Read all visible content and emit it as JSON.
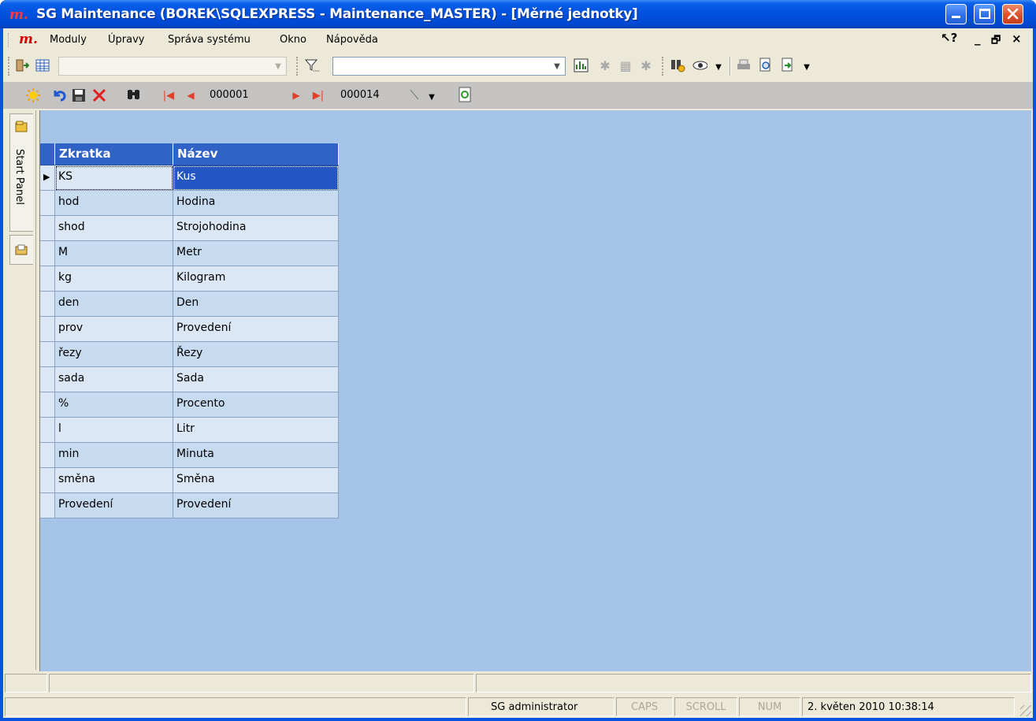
{
  "window": {
    "logo": "m.",
    "title": "SG Maintenance (BOREK\\SQLEXPRESS - Maintenance_MASTER) - [Měrné jednotky]",
    "controls": {
      "minimize": "_",
      "maximize": "□",
      "close": "✕"
    }
  },
  "menubar": {
    "logo": "m.",
    "items": [
      "Moduly",
      "Úpravy",
      "Správa systému",
      "Okno",
      "Nápověda"
    ],
    "mdi_controls": {
      "help": "↖?",
      "minimize": "_",
      "restore": "🗗",
      "close": "×"
    }
  },
  "toolbar1": {
    "icons": [
      "exit-icon",
      "grid-view-icon",
      "filter-icon",
      "chart-icon",
      "filter-clear-icon",
      "filter-edit-icon",
      "filter-remove-icon",
      "binoculars-filter-icon",
      "eye-icon",
      "printer-icon",
      "print-preview-icon",
      "export-icon"
    ],
    "view_combo_value": "",
    "filter_combo_value": ""
  },
  "toolbar2": {
    "record_current": "000001",
    "record_total": "000014",
    "icons": [
      "new-icon",
      "undo-icon",
      "save-icon",
      "delete-icon",
      "find-icon",
      "first-record-icon",
      "prev-record-icon",
      "next-record-icon",
      "last-record-icon",
      "wand-icon",
      "refresh-icon"
    ]
  },
  "sidebar": {
    "tab_label": "Start Panel"
  },
  "grid": {
    "columns": [
      "Zkratka",
      "Název"
    ],
    "rows": [
      [
        "KS",
        "Kus"
      ],
      [
        "hod",
        "Hodina"
      ],
      [
        "shod",
        "Strojohodina"
      ],
      [
        "M",
        "Metr"
      ],
      [
        "kg",
        "Kilogram"
      ],
      [
        "den",
        "Den"
      ],
      [
        "prov",
        "Provedení"
      ],
      [
        "řezy",
        "Řezy"
      ],
      [
        "sada",
        "Sada"
      ],
      [
        "%",
        "Procento"
      ],
      [
        "l",
        "Litr"
      ],
      [
        "min",
        "Minuta"
      ],
      [
        "směna",
        "Směna"
      ],
      [
        "Provedení",
        "Provedení"
      ]
    ],
    "selected_row": 0
  },
  "statusbar": {
    "user": "SG administrator",
    "caps": "CAPS",
    "scroll": "SCROLL",
    "num": "NUM",
    "datetime": "2. květen 2010 10:38:14"
  },
  "colors": {
    "titlebar": "#0053e1",
    "grid_header": "#3163c6",
    "selected_cell": "#2356c2",
    "workspace": "#a6c4e8"
  }
}
